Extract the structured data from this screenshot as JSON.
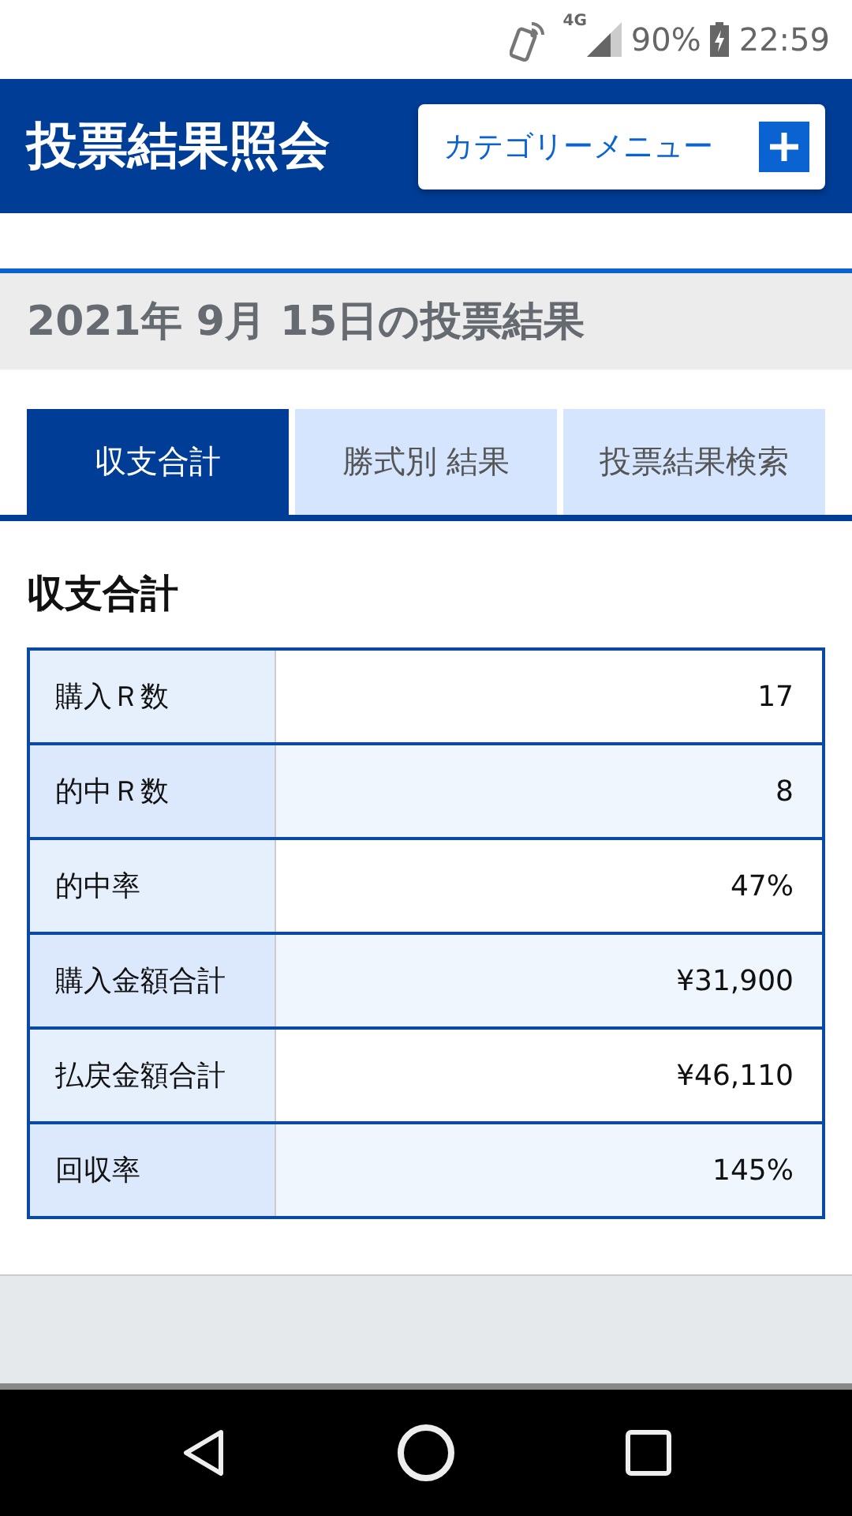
{
  "status_bar": {
    "network": "4G",
    "battery": "90%",
    "time": "22:59"
  },
  "header": {
    "title": "投票結果照会",
    "menu_button": "カテゴリーメニュー"
  },
  "date_heading": "2021年 9月 15日の投票結果",
  "tabs": [
    {
      "label": "収支合計",
      "selected": true
    },
    {
      "label": "勝式別 結果",
      "selected": false
    },
    {
      "label": "投票結果検索",
      "selected": false
    }
  ],
  "section_title": "収支合計",
  "table": {
    "rows": [
      {
        "label": "購入Ｒ数",
        "value": "17"
      },
      {
        "label": "的中Ｒ数",
        "value": "8"
      },
      {
        "label": "的中率",
        "value": "47%"
      },
      {
        "label": "購入金額合計",
        "value": "¥31,900"
      },
      {
        "label": "払戻金額合計",
        "value": "¥46,110"
      },
      {
        "label": "回収率",
        "value": "145%"
      }
    ]
  }
}
